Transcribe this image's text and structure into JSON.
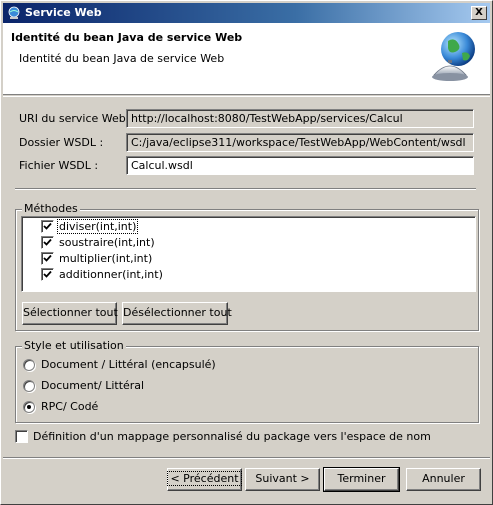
{
  "window": {
    "title": "Service Web",
    "close_label": "X"
  },
  "header": {
    "title": "Identité du bean Java de service Web",
    "description": "Identité du bean Java de service Web"
  },
  "fields": {
    "uri_label": "URI du service Web :",
    "uri_value": "http://localhost:8080/TestWebApp/services/Calcul",
    "wsdl_folder_label": "Dossier WSDL :",
    "wsdl_folder_value": "C:/java/eclipse311/workspace/TestWebApp/WebContent/wsdl",
    "wsdl_file_label": "Fichier WSDL :",
    "wsdl_file_value": "Calcul.wsdl"
  },
  "methods": {
    "legend": "Méthodes",
    "items": [
      {
        "label": "diviser(int,int)",
        "checked": true
      },
      {
        "label": "soustraire(int,int)",
        "checked": true
      },
      {
        "label": "multiplier(int,int)",
        "checked": true
      },
      {
        "label": "additionner(int,int)",
        "checked": true
      }
    ],
    "select_all": "Sélectionner tout",
    "deselect_all": "Désélectionner tout"
  },
  "style": {
    "legend": "Style et utilisation",
    "options": [
      {
        "label": "Document / Littéral (encapsulé)",
        "selected": false
      },
      {
        "label": "Document/ Littéral",
        "selected": false
      },
      {
        "label": "RPC/ Codé",
        "selected": true
      }
    ]
  },
  "custom_mapping": {
    "label": "Définition d'un mappage personnalisé du package vers l'espace de nom",
    "checked": false
  },
  "buttons": {
    "back": "< Précédent",
    "next": "Suivant >",
    "finish": "Terminer",
    "cancel": "Annuler"
  },
  "colors": {
    "title_bar_start": "#0a246a",
    "title_bar_end": "#a6caf0",
    "dialog_bg": "#d4d0c8"
  },
  "icons": {
    "title": "web-service-icon",
    "banner": "globe-service-bell-icon"
  }
}
